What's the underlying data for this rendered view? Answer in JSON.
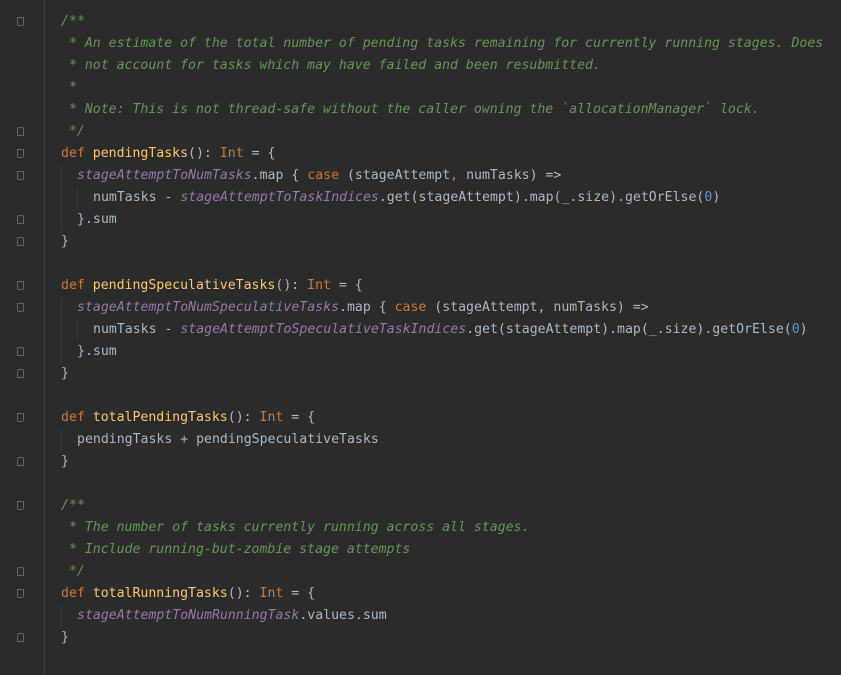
{
  "editor": {
    "language": "scala",
    "colors": {
      "background": "#2b2b2b",
      "text": "#a9b7c6",
      "keyword": "#cc7832",
      "function": "#ffc66d",
      "field": "#9876aa",
      "doc_comment": "#629755",
      "number": "#6897bb"
    },
    "lines": [
      {
        "fold": "open",
        "indent": 0,
        "tokens": [
          {
            "t": "/**",
            "c": "doc"
          }
        ]
      },
      {
        "indent": 0,
        "tokens": [
          {
            "t": " * An estimate of the total number of pending tasks remaining for currently running stages. Does",
            "c": "doc"
          }
        ]
      },
      {
        "indent": 0,
        "tokens": [
          {
            "t": " * not account for tasks which may have failed and been resubmitted.",
            "c": "doc"
          }
        ]
      },
      {
        "indent": 0,
        "tokens": [
          {
            "t": " *",
            "c": "doc"
          }
        ]
      },
      {
        "indent": 0,
        "tokens": [
          {
            "t": " * Note: This is not thread-safe without the caller owning the `allocationManager` lock.",
            "c": "doc"
          }
        ]
      },
      {
        "fold": "close",
        "indent": 0,
        "tokens": [
          {
            "t": " */",
            "c": "doc"
          }
        ]
      },
      {
        "fold": "open",
        "indent": 0,
        "tokens": [
          {
            "t": "def ",
            "c": "kw"
          },
          {
            "t": "pendingTasks",
            "c": "fn"
          },
          {
            "t": "(): "
          },
          {
            "t": "Int",
            "c": "kw"
          },
          {
            "t": " = {"
          }
        ]
      },
      {
        "fold": "open",
        "indent": 1,
        "tokens": [
          {
            "t": "stageAttemptToNumTasks",
            "c": "fld"
          },
          {
            "t": ".map { "
          },
          {
            "t": "case",
            "c": "kw"
          },
          {
            "t": " (stageAttempt"
          },
          {
            "t": ",",
            "c": "kw"
          },
          {
            "t": " numTasks) =>"
          }
        ]
      },
      {
        "indent": 2,
        "tokens": [
          {
            "t": "numTasks - "
          },
          {
            "t": "stageAttemptToTaskIndices",
            "c": "fld"
          },
          {
            "t": ".get(stageAttempt).map(_.size).getOrElse("
          },
          {
            "t": "0",
            "c": "num"
          },
          {
            "t": ")"
          }
        ]
      },
      {
        "fold": "close",
        "indent": 1,
        "tokens": [
          {
            "t": "}.sum"
          }
        ]
      },
      {
        "fold": "close",
        "indent": 0,
        "tokens": [
          {
            "t": "}"
          }
        ]
      },
      {
        "indent": 0,
        "tokens": []
      },
      {
        "fold": "open",
        "indent": 0,
        "tokens": [
          {
            "t": "def ",
            "c": "kw"
          },
          {
            "t": "pendingSpeculativeTasks",
            "c": "fn"
          },
          {
            "t": "(): "
          },
          {
            "t": "Int",
            "c": "kw"
          },
          {
            "t": " = {"
          }
        ]
      },
      {
        "fold": "open",
        "indent": 1,
        "tokens": [
          {
            "t": "stageAttemptToNumSpeculativeTasks",
            "c": "fld"
          },
          {
            "t": ".map { "
          },
          {
            "t": "case",
            "c": "kw"
          },
          {
            "t": " (stageAttempt, numTasks) =>"
          }
        ]
      },
      {
        "indent": 2,
        "tokens": [
          {
            "t": "numTasks - "
          },
          {
            "t": "stageAttemptToSpeculativeTaskIndices",
            "c": "fld"
          },
          {
            "t": ".get(stageAttempt).map(_.size).getOrElse("
          },
          {
            "t": "0",
            "c": "num"
          },
          {
            "t": ")"
          }
        ]
      },
      {
        "fold": "close",
        "indent": 1,
        "tokens": [
          {
            "t": "}.sum"
          }
        ]
      },
      {
        "fold": "close",
        "indent": 0,
        "tokens": [
          {
            "t": "}"
          }
        ]
      },
      {
        "indent": 0,
        "tokens": []
      },
      {
        "fold": "open",
        "indent": 0,
        "tokens": [
          {
            "t": "def ",
            "c": "kw"
          },
          {
            "t": "totalPendingTasks",
            "c": "fn"
          },
          {
            "t": "(): "
          },
          {
            "t": "Int",
            "c": "kw"
          },
          {
            "t": " = {"
          }
        ]
      },
      {
        "indent": 1,
        "tokens": [
          {
            "t": "pendingTasks + pendingSpeculativeTasks"
          }
        ]
      },
      {
        "fold": "close",
        "indent": 0,
        "tokens": [
          {
            "t": "}"
          }
        ]
      },
      {
        "indent": 0,
        "tokens": []
      },
      {
        "fold": "open",
        "indent": 0,
        "tokens": [
          {
            "t": "/**",
            "c": "doc"
          }
        ]
      },
      {
        "indent": 0,
        "tokens": [
          {
            "t": " * The number of tasks currently running across all stages.",
            "c": "doc"
          }
        ]
      },
      {
        "indent": 0,
        "tokens": [
          {
            "t": " * Include running-but-zombie stage attempts",
            "c": "doc"
          }
        ]
      },
      {
        "fold": "close",
        "indent": 0,
        "tokens": [
          {
            "t": " */",
            "c": "doc"
          }
        ]
      },
      {
        "fold": "open",
        "indent": 0,
        "tokens": [
          {
            "t": "def ",
            "c": "kw"
          },
          {
            "t": "totalRunningTasks",
            "c": "fn"
          },
          {
            "t": "(): "
          },
          {
            "t": "Int",
            "c": "kw"
          },
          {
            "t": " = {"
          }
        ]
      },
      {
        "indent": 1,
        "tokens": [
          {
            "t": "stageAttemptToNumRunningTask",
            "c": "fld"
          },
          {
            "t": ".values.sum"
          }
        ]
      },
      {
        "fold": "close",
        "indent": 0,
        "tokens": [
          {
            "t": "}"
          }
        ]
      }
    ]
  }
}
